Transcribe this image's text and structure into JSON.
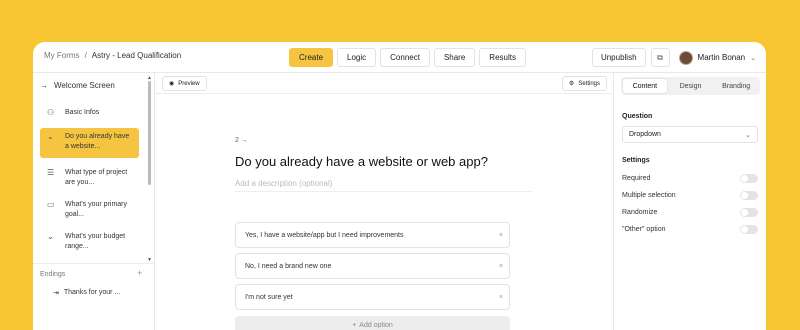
{
  "breadcrumb": {
    "root": "My Forms",
    "separator": "/",
    "current": "Astry - Lead Qualification"
  },
  "tabs": [
    {
      "label": "Create",
      "active": true
    },
    {
      "label": "Logic",
      "active": false
    },
    {
      "label": "Connect",
      "active": false
    },
    {
      "label": "Share",
      "active": false
    },
    {
      "label": "Results",
      "active": false
    }
  ],
  "topright": {
    "unpublish": "Unpublish",
    "user_name": "Martin Bonan"
  },
  "sidebar": {
    "welcome": "Welcome Screen",
    "items": [
      {
        "label": "Basic Infos",
        "icon": "user-icon"
      },
      {
        "label": "Do you already have a website...",
        "icon": "chevron-down-icon",
        "active": true
      },
      {
        "label": "What type of project are you...",
        "icon": "list-icon"
      },
      {
        "label": "What's your primary goal...",
        "icon": "message-icon"
      },
      {
        "label": "What's your budget range...",
        "icon": "chevron-down-icon"
      }
    ],
    "endings_label": "Endings",
    "ending_item": "Thanks for your ..."
  },
  "canvas": {
    "preview": "Preview",
    "settings": "Settings",
    "question_number": "2 →",
    "question_title": "Do you already have a website or web app?",
    "description_placeholder": "Add a description (optional)",
    "options": [
      "Yes, I have a website/app but I need improvements",
      "No, I need a brand new one",
      "I'm not sure yet"
    ],
    "add_option": "Add option"
  },
  "right_panel": {
    "tabs": [
      {
        "label": "Content",
        "active": true
      },
      {
        "label": "Design",
        "active": false
      },
      {
        "label": "Branding",
        "active": false
      }
    ],
    "question_label": "Question",
    "question_type": "Dropdown",
    "settings_label": "Settings",
    "settings": [
      {
        "label": "Required",
        "on": false
      },
      {
        "label": "Multiple selection",
        "on": false
      },
      {
        "label": "Randomize",
        "on": false
      },
      {
        "label": "\"Other\" option",
        "on": false
      }
    ]
  },
  "colors": {
    "accent": "#f5c542",
    "background": "#f8c632"
  }
}
